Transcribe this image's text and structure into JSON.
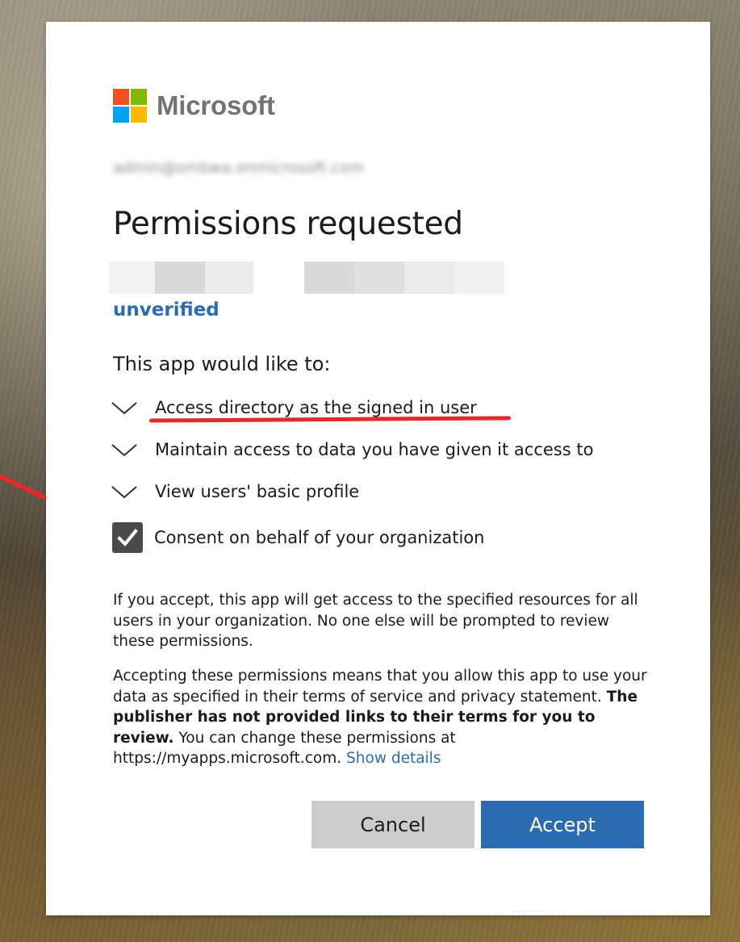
{
  "brand": {
    "name": "Microsoft",
    "logo_colors": [
      "#f25022",
      "#7fba00",
      "#00a4ef",
      "#ffb900"
    ]
  },
  "account": {
    "email": "admin@smbwa.onmicrosoft.com"
  },
  "header": {
    "title": "Permissions requested",
    "publisher_status": "unverified"
  },
  "app_name_placeholder_colors": [
    "#f2f2f2",
    "#d9d9d9",
    "#ebebeb",
    "#ffffff",
    "#d9d9d9",
    "#e0e0e0",
    "#ebebeb",
    "#f0f0f0"
  ],
  "permissions": {
    "intro": "This app would like to:",
    "items": [
      {
        "label": "Access directory as the signed in user",
        "icon": "chevron-down-icon"
      },
      {
        "label": "Maintain access to data you have given it access to",
        "icon": "chevron-down-icon"
      },
      {
        "label": "View users' basic profile",
        "icon": "chevron-down-icon"
      }
    ]
  },
  "consent": {
    "checked": true,
    "label": "Consent on behalf of your organization",
    "icon": "checkmark-icon"
  },
  "info": {
    "paragraph1": "If you accept, this app will get access to the specified resources for all users in your organization. No one else will be prompted to review these permissions.",
    "paragraph2_start": "Accepting these permissions means that you allow this app to use your data as specified in their terms of service and privacy statement. ",
    "paragraph2_bold": "The publisher has not provided links to their terms for you to review.",
    "paragraph2_end": " You can change these permissions at https://myapps.microsoft.com. ",
    "show_details_link": "Show details"
  },
  "actions": {
    "cancel_label": "Cancel",
    "accept_label": "Accept"
  },
  "colors": {
    "accent": "#2b6cb0",
    "annotation": "#e02b2b"
  }
}
